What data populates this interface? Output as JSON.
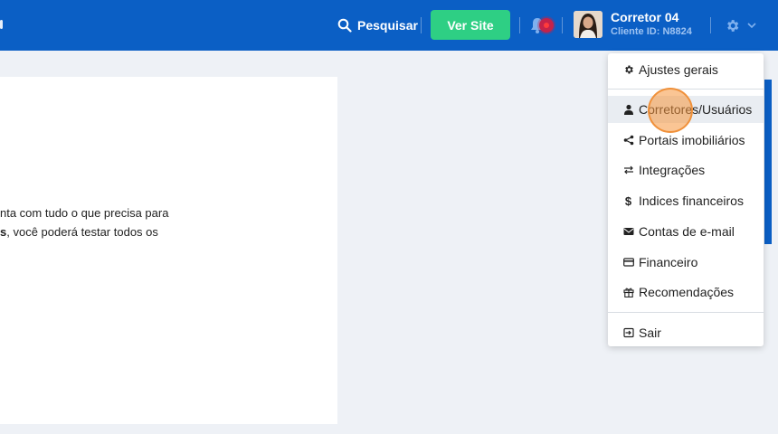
{
  "header": {
    "search_label": "Pesquisar",
    "search_icon": "search-icon",
    "ver_site_label": "Ver Site",
    "user_name": "Corretor 04",
    "client_id": "Cliente ID: N8824"
  },
  "content": {
    "line1": "nta com tudo o que precisa para",
    "line2_bold": "s",
    "line2_rest": ", você poderá testar todos os"
  },
  "menu": {
    "items": [
      {
        "label": "Ajustes gerais",
        "icon": "gear-icon"
      },
      {
        "label": "Corretores/Usuários",
        "icon": "user-icon"
      },
      {
        "label": "Portais imobiliários",
        "icon": "share-icon"
      },
      {
        "label": "Integrações",
        "icon": "exchange-icon"
      },
      {
        "label": "Indices financeiros",
        "icon": "dollar-icon"
      },
      {
        "label": "Contas de e-mail",
        "icon": "envelope-icon"
      },
      {
        "label": "Financeiro",
        "icon": "credit-card-icon"
      },
      {
        "label": "Recomendações",
        "icon": "gift-icon"
      },
      {
        "label": "Sair",
        "icon": "sign-out-icon"
      }
    ]
  },
  "colors": {
    "header_bg": "#0b5fc5",
    "ver_site_bg": "#2ecf84",
    "page_bg": "#eef1f6",
    "notification": "#c4234a"
  }
}
